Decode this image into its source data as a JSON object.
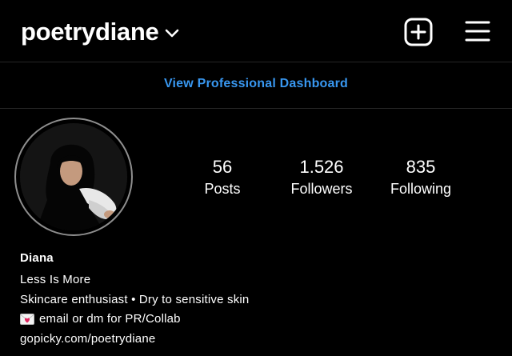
{
  "header": {
    "username": "poetrydiane",
    "username_chevron_icon": "chevron-down-icon",
    "new_post_icon": "plus-square-icon",
    "menu_icon": "hamburger-menu-icon"
  },
  "dashboard": {
    "link_label": "View Professional Dashboard",
    "link_color": "#3897f0"
  },
  "profile": {
    "avatar_alt": "profile photo",
    "stats": [
      {
        "value": "56",
        "label": "Posts"
      },
      {
        "value": "1.526",
        "label": "Followers"
      },
      {
        "value": "835",
        "label": "Following"
      }
    ]
  },
  "bio": {
    "name": "Diana",
    "line1": "Less Is More",
    "line2": "Skincare enthusiast • Dry to sensitive skin",
    "line3_icon": "love-letter-icon",
    "line3": "email or dm for PR/Collab",
    "link": "gopicky.com/poetrydiane"
  },
  "colors": {
    "background": "#000000",
    "text": "#ffffff",
    "divider": "#262626",
    "accent": "#3897f0"
  }
}
